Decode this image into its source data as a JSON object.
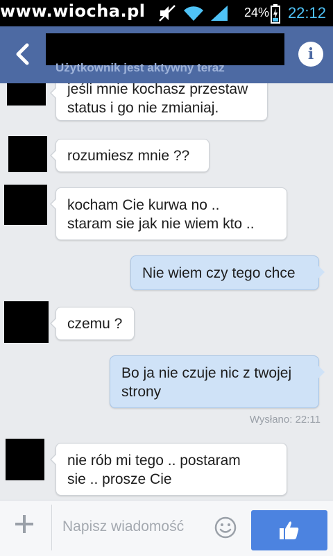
{
  "status_bar": {
    "watermark": "www.wiocha.pl",
    "battery": "24%",
    "time": "22:12"
  },
  "header": {
    "subtitle": "Użytkownik jest aktywny teraz"
  },
  "messages": [
    {
      "direction": "in",
      "lines": [
        "jeśli mnie kochasz przestaw",
        "status i go nie zmianiaj."
      ]
    },
    {
      "direction": "in",
      "lines": [
        "rozumiesz mnie ??"
      ]
    },
    {
      "direction": "in",
      "lines": [
        "kocham Cie kurwa no ..",
        "staram sie jak nie wiem kto .."
      ]
    },
    {
      "direction": "out",
      "lines": [
        "Nie wiem czy tego chce"
      ]
    },
    {
      "direction": "in",
      "lines": [
        "czemu ?"
      ]
    },
    {
      "direction": "out",
      "lines": [
        "Bo ja nie czuje nic z twojej",
        "strony"
      ]
    },
    {
      "direction": "in",
      "lines": [
        "nie rób mi tego .. postaram",
        "sie .. prosze Cie"
      ]
    }
  ],
  "sent_status": "Wysłano: 22:11",
  "composer": {
    "placeholder": "Napisz wiadomość"
  },
  "colors": {
    "header": "#4d6aa3",
    "outgoing_bubble": "#cfe2f7",
    "like_button": "#4c83e0"
  },
  "icons": {
    "back": "chevron-left-icon",
    "info": "info-icon",
    "add": "plus-icon",
    "emoji": "smiley-icon",
    "like": "thumbs-up-icon"
  }
}
